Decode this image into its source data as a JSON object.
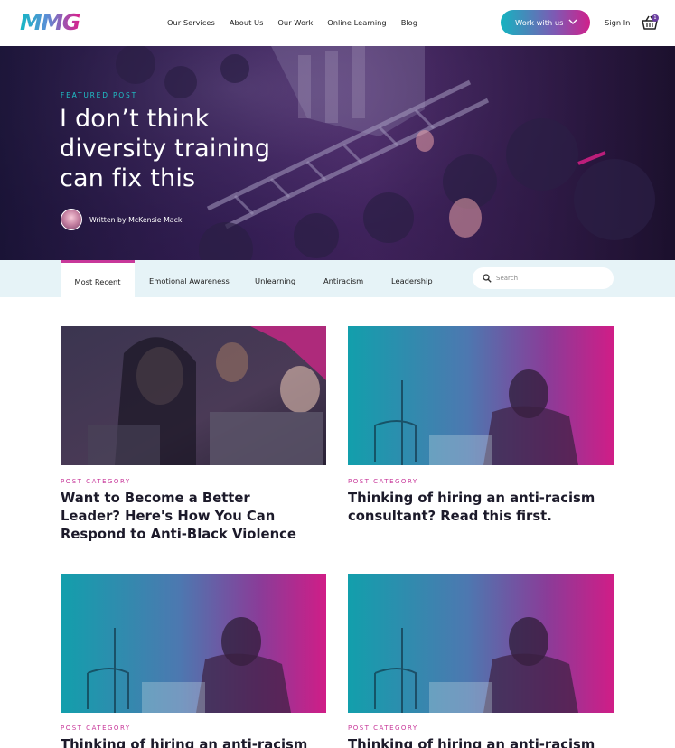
{
  "header": {
    "logo": "MMG",
    "nav": [
      "Our Services",
      "About Us",
      "Our Work",
      "Online Learning",
      "Blog"
    ],
    "work_button": "Work with us",
    "sign_in": "Sign In",
    "cart_count": "1"
  },
  "hero": {
    "eyebrow": "FEATURED POST",
    "title": "I don’t think diversity training can fix this",
    "author": "Written by McKensie Mack"
  },
  "tabs": {
    "items": [
      "Most Recent",
      "Emotional Awareness",
      "Unlearning",
      "Antiracism",
      "Leadership"
    ],
    "active": "Most Recent"
  },
  "search": {
    "placeholder": "Search"
  },
  "posts": [
    {
      "category": "POST CATEGORY",
      "title": "Want to Become a Better Leader? Here's How You Can Respond to Anti-Black Violence"
    },
    {
      "category": "POST CATEGORY",
      "title": "Thinking of hiring an anti-racism consultant? Read this first."
    },
    {
      "category": "POST CATEGORY",
      "title": "Thinking of hiring an anti-racism consultant? Read this first."
    },
    {
      "category": "POST CATEGORY",
      "title": "Thinking of hiring an anti-racism consultant? Read this first."
    }
  ],
  "colors": {
    "teal": "#14b8c4",
    "magenta": "#d0208b",
    "tab_bg": "#e6f3f7"
  }
}
